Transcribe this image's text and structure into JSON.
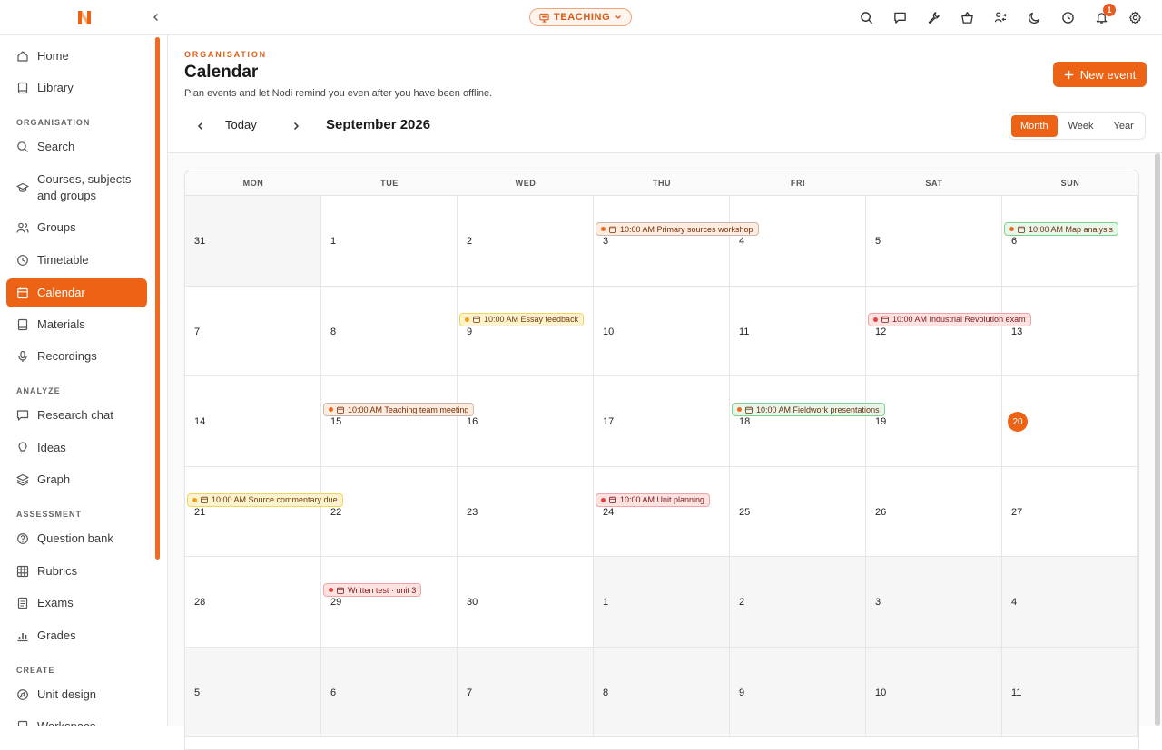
{
  "brand": {
    "logo_letter": "N",
    "accent": "#ec6316"
  },
  "topbar": {
    "mode_label": "TEACHING",
    "icons": [
      "search-icon",
      "chat-icon",
      "wrench-icon",
      "basket-icon",
      "users-switch-icon",
      "moon-icon",
      "history-icon",
      "bell-icon",
      "gear-icon"
    ],
    "notification_count": "1"
  },
  "sidebar": {
    "items_top": [
      {
        "label": "Home",
        "icon": "home-icon"
      },
      {
        "label": "Library",
        "icon": "book-icon"
      }
    ],
    "sections": [
      {
        "title": "ORGANISATION",
        "items": [
          {
            "label": "Search",
            "icon": "search-icon"
          },
          {
            "label": "Courses, subjects and groups",
            "icon": "graduation-cap-icon"
          },
          {
            "label": "Groups",
            "icon": "users-icon"
          },
          {
            "label": "Timetable",
            "icon": "clock-icon"
          },
          {
            "label": "Calendar",
            "icon": "calendar-icon",
            "active": true
          },
          {
            "label": "Materials",
            "icon": "book-icon"
          },
          {
            "label": "Recordings",
            "icon": "microphone-icon"
          }
        ]
      },
      {
        "title": "ANALYZE",
        "items": [
          {
            "label": "Research chat",
            "icon": "chat-icon"
          },
          {
            "label": "Ideas",
            "icon": "lightbulb-icon"
          },
          {
            "label": "Graph",
            "icon": "layers-icon"
          }
        ]
      },
      {
        "title": "ASSESSMENT",
        "items": [
          {
            "label": "Question bank",
            "icon": "question-icon"
          },
          {
            "label": "Rubrics",
            "icon": "grid-icon"
          },
          {
            "label": "Exams",
            "icon": "document-icon"
          },
          {
            "label": "Grades",
            "icon": "bar-chart-icon"
          }
        ]
      },
      {
        "title": "CREATE",
        "items": [
          {
            "label": "Unit design",
            "icon": "compass-icon"
          },
          {
            "label": "Workspace",
            "icon": "folder-icon"
          }
        ]
      }
    ]
  },
  "header": {
    "eyebrow": "ORGANISATION",
    "title": "Calendar",
    "subtitle": "Plan events and let Nodi remind you even after you have been offline.",
    "new_event_label": "New event"
  },
  "toolbar": {
    "today_label": "Today",
    "month_label": "September 2026",
    "views": [
      "Month",
      "Week",
      "Year"
    ],
    "active_view": "Month"
  },
  "calendar": {
    "weekdays": [
      "MON",
      "TUE",
      "WED",
      "THU",
      "FRI",
      "SAT",
      "SUN"
    ],
    "weeks": [
      [
        {
          "d": "31",
          "muted": true
        },
        {
          "d": "1"
        },
        {
          "d": "2"
        },
        {
          "d": "3"
        },
        {
          "d": "4"
        },
        {
          "d": "5"
        },
        {
          "d": "6"
        }
      ],
      [
        {
          "d": "7"
        },
        {
          "d": "8"
        },
        {
          "d": "9"
        },
        {
          "d": "10"
        },
        {
          "d": "11"
        },
        {
          "d": "12"
        },
        {
          "d": "13"
        }
      ],
      [
        {
          "d": "14"
        },
        {
          "d": "15"
        },
        {
          "d": "16"
        },
        {
          "d": "17"
        },
        {
          "d": "18"
        },
        {
          "d": "19"
        },
        {
          "d": "20",
          "today": true
        }
      ],
      [
        {
          "d": "21"
        },
        {
          "d": "22"
        },
        {
          "d": "23"
        },
        {
          "d": "24"
        },
        {
          "d": "25"
        },
        {
          "d": "26"
        },
        {
          "d": "27"
        }
      ],
      [
        {
          "d": "28"
        },
        {
          "d": "29"
        },
        {
          "d": "30"
        },
        {
          "d": "1",
          "muted": true
        },
        {
          "d": "2",
          "muted": true
        },
        {
          "d": "3",
          "muted": true
        },
        {
          "d": "4",
          "muted": true
        }
      ],
      [
        {
          "d": "5",
          "muted": true
        },
        {
          "d": "6",
          "muted": true
        },
        {
          "d": "7",
          "muted": true
        },
        {
          "d": "8",
          "muted": true
        },
        {
          "d": "9",
          "muted": true
        },
        {
          "d": "10",
          "muted": true
        },
        {
          "d": "11",
          "muted": true
        }
      ]
    ],
    "events": [
      {
        "week": 0,
        "day": 3,
        "label": "10:00 AM Primary sources workshop",
        "color": "orange"
      },
      {
        "week": 0,
        "day": 6,
        "label": "10:00 AM Map analysis",
        "color": "green"
      },
      {
        "week": 1,
        "day": 2,
        "label": "10:00 AM Essay feedback",
        "color": "yellow"
      },
      {
        "week": 1,
        "day": 5,
        "label": "10:00 AM Industrial Revolution exam",
        "color": "red"
      },
      {
        "week": 2,
        "day": 1,
        "label": "10:00 AM Teaching team meeting",
        "color": "orange"
      },
      {
        "week": 2,
        "day": 4,
        "label": "10:00 AM Fieldwork presentations",
        "color": "green"
      },
      {
        "week": 3,
        "day": 0,
        "label": "10:00 AM Source commentary due",
        "color": "yellow"
      },
      {
        "week": 3,
        "day": 3,
        "label": "10:00 AM Unit planning",
        "color": "red"
      },
      {
        "week": 4,
        "day": 1,
        "label": "Written test · unit 3",
        "color": "red"
      }
    ]
  }
}
